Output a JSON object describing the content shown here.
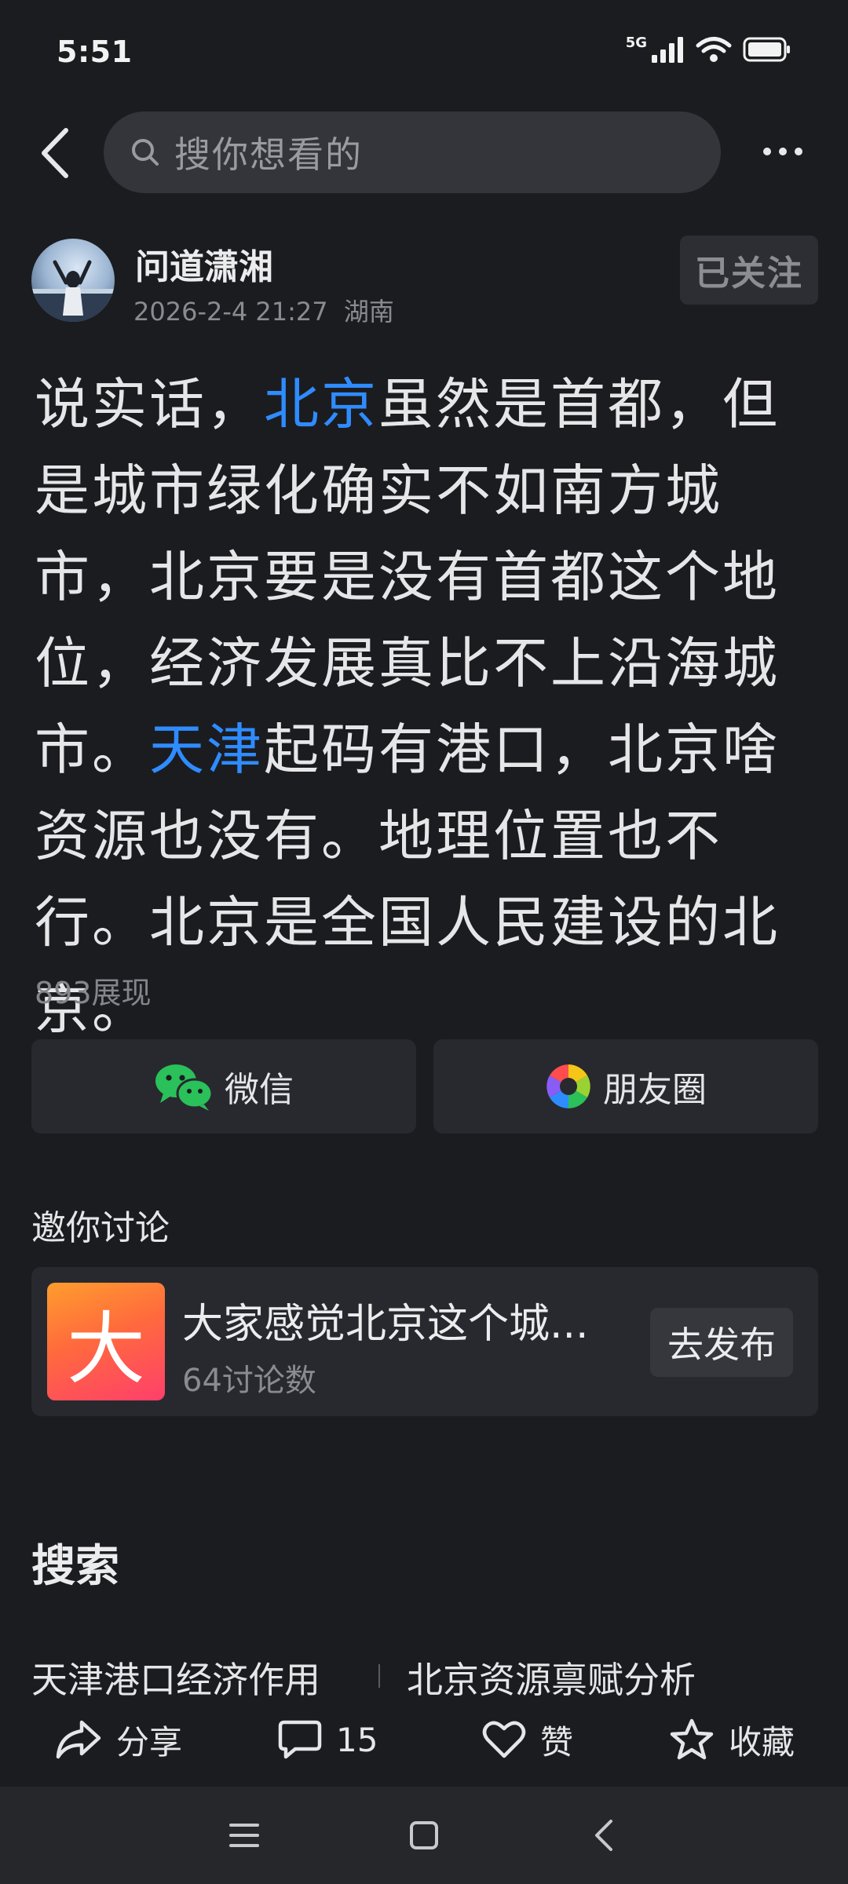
{
  "status_bar": {
    "time": "5:51",
    "network": "5G"
  },
  "top_nav": {
    "search_placeholder": "搜你想看的"
  },
  "author": {
    "name": "问道潇湘",
    "datetime": "2026-2-4 21:27",
    "location": "湖南",
    "follow_label": "已关注"
  },
  "post": {
    "segments": [
      {
        "text": "说实话，",
        "highlight": false
      },
      {
        "text": "北京",
        "highlight": true
      },
      {
        "text": "虽然是首都，但是城市绿化确实不如南方城市，北京要是没有首都这个地位，经济发展真比不上沿海城市。",
        "highlight": false
      },
      {
        "text": "天津",
        "highlight": true
      },
      {
        "text": "起码有港口，北京啥资源也没有。地理位置也不行。北京是全国人民建设的北京。",
        "highlight": false
      }
    ],
    "views": "893展现"
  },
  "share": {
    "wechat_label": "微信",
    "moments_label": "朋友圈"
  },
  "invite": {
    "heading": "邀你讨论",
    "topic": {
      "thumb_char": "大",
      "title": "大家感觉北京这个城...",
      "count": "64讨论数",
      "publish_label": "去发布"
    }
  },
  "search_section": {
    "heading": "搜索",
    "suggestions": [
      "天津港口经济作用",
      "北京资源禀赋分析"
    ]
  },
  "action_bar": {
    "share_label": "分享",
    "comment_count": "15",
    "like_label": "赞",
    "favorite_label": "收藏"
  },
  "colors": {
    "background": "#1b1c20",
    "highlight": "#2f8cff",
    "card": "#28292e"
  }
}
